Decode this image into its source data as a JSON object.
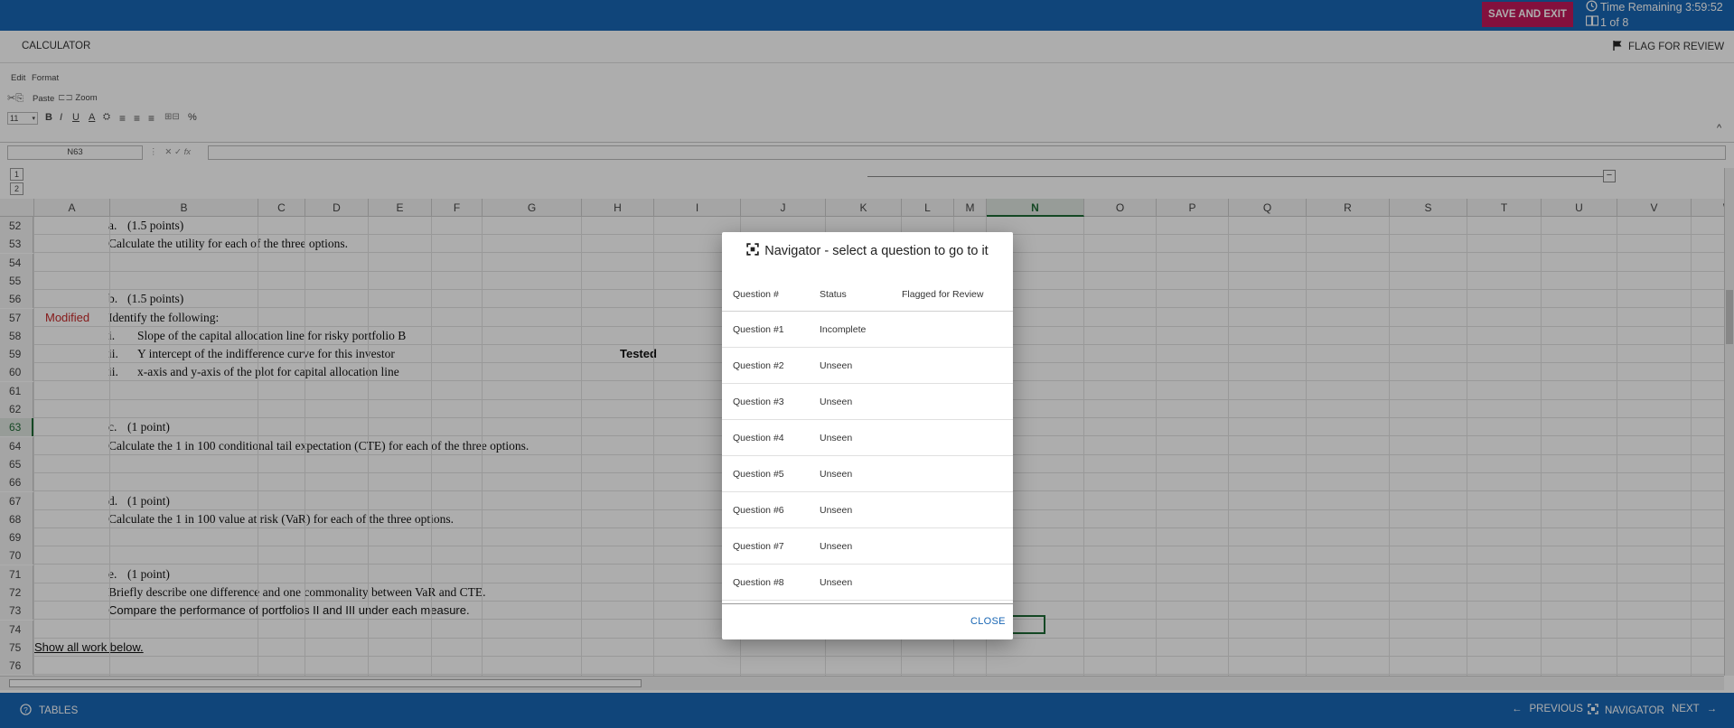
{
  "topbar": {
    "save_exit_label": "SAVE AND EXIT",
    "time_remaining": "Time Remaining 3:59:52",
    "question_count": "1 of 8",
    "bg_color": "#1866b4",
    "save_color": "#c2185b"
  },
  "calc_bar": {
    "calculator_label": "CALCULATOR",
    "flag_label": "FLAG FOR REVIEW"
  },
  "ribbon": {
    "menu_edit": "Edit",
    "menu_format": "Format",
    "paste_label": "Paste",
    "zoom_label": "Zoom",
    "font_size": "11",
    "percent_label": "%"
  },
  "formula_bar": {
    "name_box": "N63",
    "fx_label": "fx"
  },
  "outline": {
    "level1": "1",
    "level2": "2",
    "collapse": "−"
  },
  "sheet": {
    "columns": [
      "A",
      "B",
      "C",
      "D",
      "E",
      "F",
      "G",
      "H",
      "I",
      "J",
      "K",
      "L",
      "M",
      "N",
      "O",
      "P",
      "Q",
      "R",
      "S",
      "T",
      "U",
      "V",
      "W"
    ],
    "selected_column": "N",
    "selected_row": "63",
    "rows": [
      {
        "num": "52",
        "label": "a.",
        "text": "(1.5 points)"
      },
      {
        "num": "53",
        "text": "Calculate the utility for each of the three options."
      },
      {
        "num": "54"
      },
      {
        "num": "55"
      },
      {
        "num": "56",
        "label": "b.",
        "text": "(1.5 points)"
      },
      {
        "num": "57",
        "text": "Identify the following:",
        "a_text": "Modified"
      },
      {
        "num": "58",
        "label": "i.",
        "text": "Slope of the capital allocation line for risky portfolio B"
      },
      {
        "num": "59",
        "label": "ii.",
        "text": "Y intercept of the indifference curve for this investor",
        "i_text": "Tested"
      },
      {
        "num": "60",
        "label": "ii.",
        "text": "x-axis and y-axis of the plot for capital allocation line"
      },
      {
        "num": "61"
      },
      {
        "num": "62"
      },
      {
        "num": "63",
        "label": "c.",
        "text": "(1 point)"
      },
      {
        "num": "64",
        "text": "Calculate the 1 in 100 conditional tail expectation (CTE) for each of the three options."
      },
      {
        "num": "65"
      },
      {
        "num": "66"
      },
      {
        "num": "67",
        "label": "d.",
        "text": "(1 point)"
      },
      {
        "num": "68",
        "text": "Calculate the 1 in 100 value at risk (VaR) for each of the three options."
      },
      {
        "num": "69"
      },
      {
        "num": "70"
      },
      {
        "num": "71",
        "label": "e.",
        "text": "(1 point)"
      },
      {
        "num": "72",
        "text": "Briefly describe one difference and one commonality between VaR and CTE."
      },
      {
        "num": "73",
        "text": "Compare the performance of portfolios II and III under each measure.",
        "sans": true
      },
      {
        "num": "74"
      },
      {
        "num": "75",
        "a_link": "Show all work below."
      },
      {
        "num": "76"
      }
    ]
  },
  "bottombar": {
    "tables_label": "TABLES",
    "previous_label": "PREVIOUS",
    "navigator_label": "NAVIGATOR",
    "next_label": "NEXT"
  },
  "navigator_modal": {
    "title": "Navigator - select a question to go to it",
    "headers": {
      "question": "Question #",
      "status": "Status",
      "flagged": "Flagged for Review"
    },
    "questions": [
      {
        "label": "Question #1",
        "status": "Incomplete",
        "flagged": ""
      },
      {
        "label": "Question #2",
        "status": "Unseen",
        "flagged": ""
      },
      {
        "label": "Question #3",
        "status": "Unseen",
        "flagged": ""
      },
      {
        "label": "Question #4",
        "status": "Unseen",
        "flagged": ""
      },
      {
        "label": "Question #5",
        "status": "Unseen",
        "flagged": ""
      },
      {
        "label": "Question #6",
        "status": "Unseen",
        "flagged": ""
      },
      {
        "label": "Question #7",
        "status": "Unseen",
        "flagged": ""
      },
      {
        "label": "Question #8",
        "status": "Unseen",
        "flagged": ""
      }
    ],
    "close_label": "CLOSE"
  }
}
